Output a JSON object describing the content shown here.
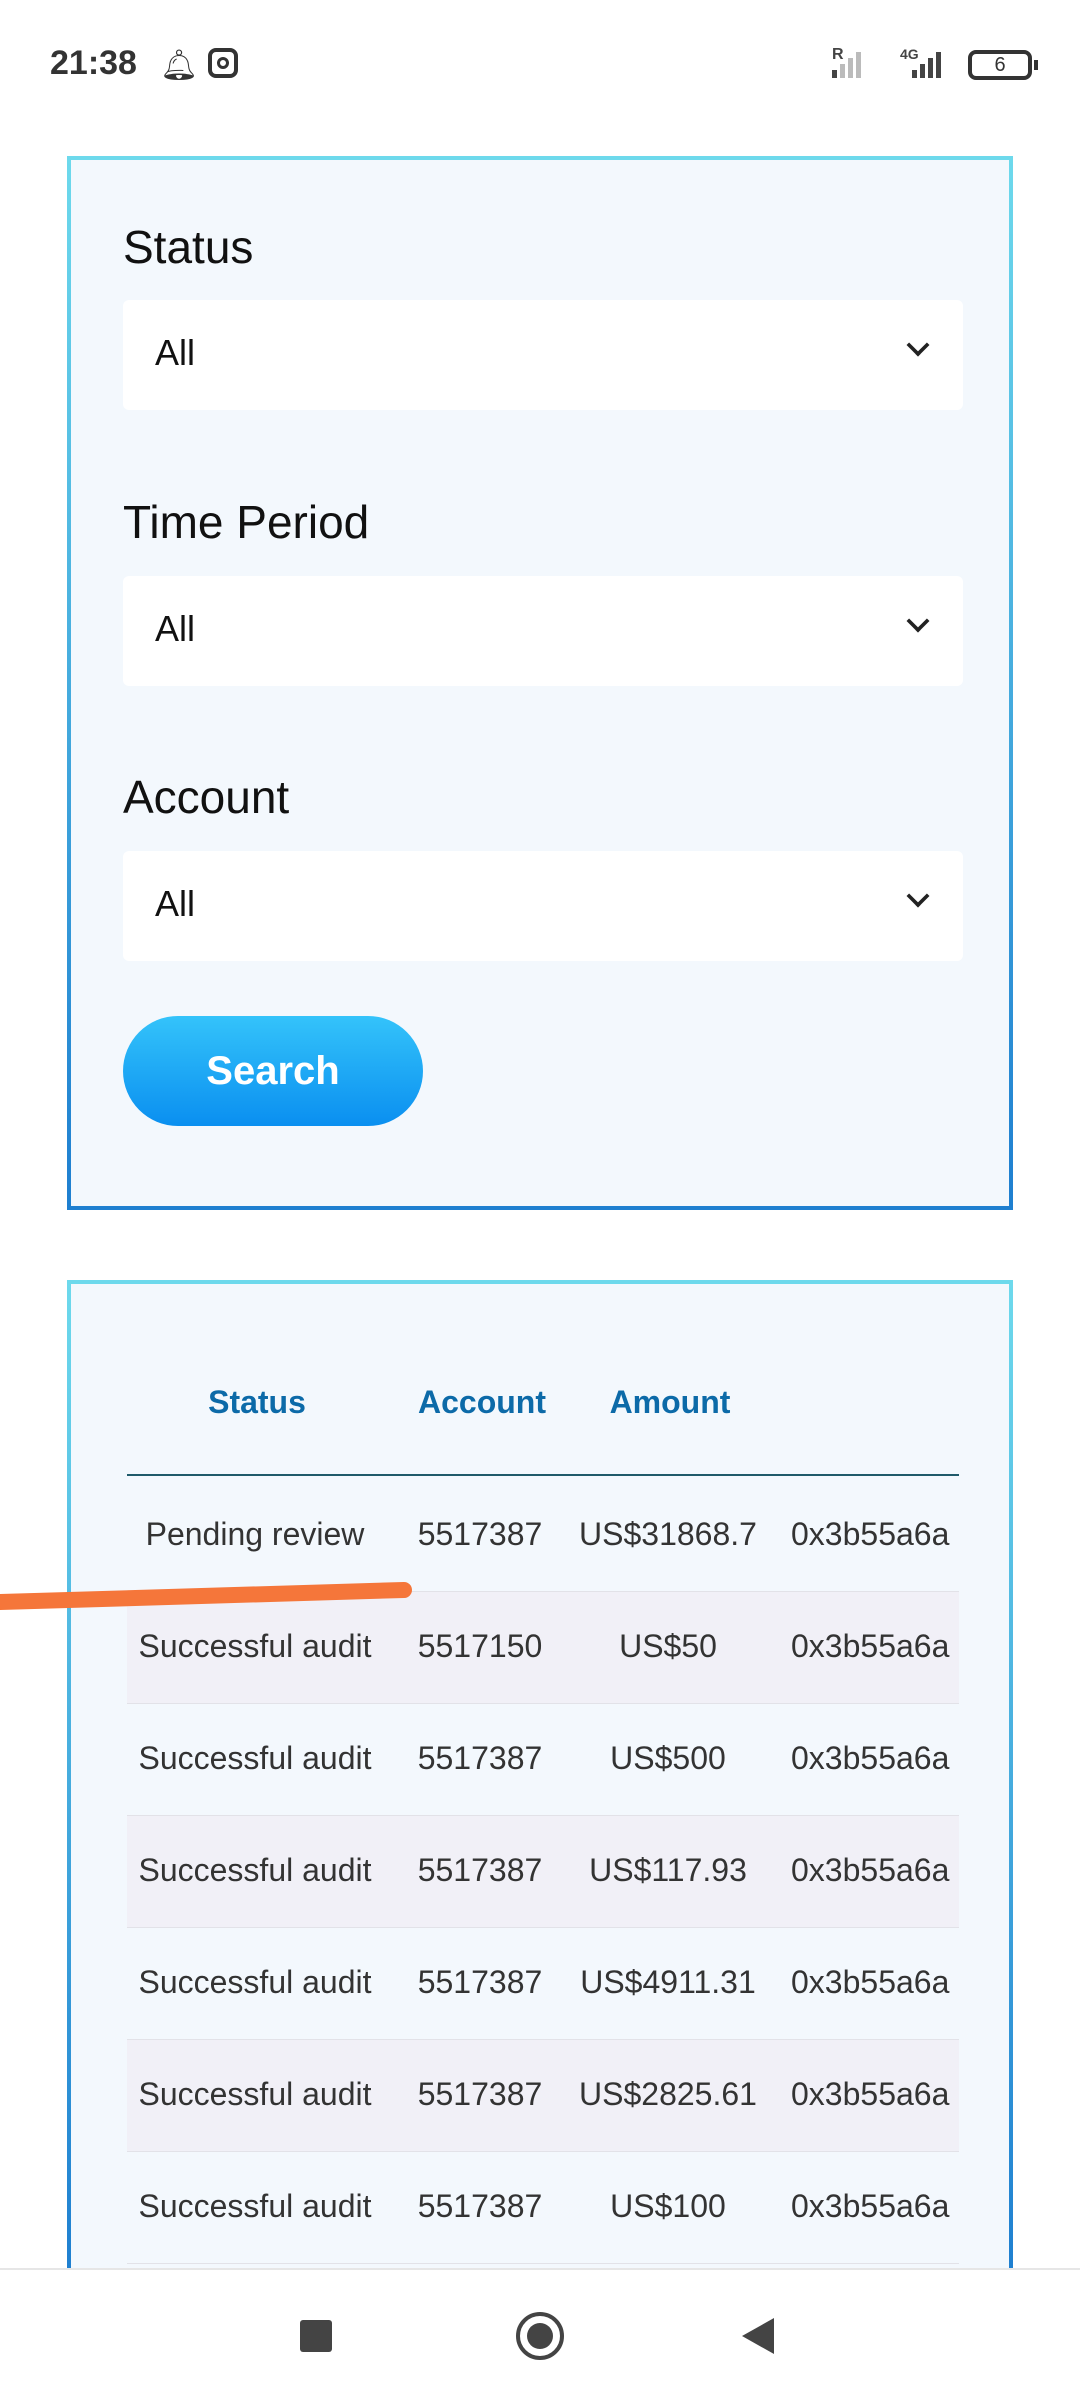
{
  "status_bar": {
    "time": "21:38",
    "signal1_label": "R",
    "signal2_label": "4G",
    "battery": "6"
  },
  "filters": {
    "status": {
      "label": "Status",
      "value": "All"
    },
    "time_period": {
      "label": "Time Period",
      "value": "All"
    },
    "account": {
      "label": "Account",
      "value": "All"
    },
    "search_label": "Search"
  },
  "table": {
    "headers": [
      "Status",
      "Account",
      "Amount"
    ],
    "rows": [
      [
        "Pending review",
        "5517387",
        "US$31868.7",
        "0x3b55a6a"
      ],
      [
        "Successful audit",
        "5517150",
        "US$50",
        "0x3b55a6a"
      ],
      [
        "Successful audit",
        "5517387",
        "US$500",
        "0x3b55a6a"
      ],
      [
        "Successful audit",
        "5517387",
        "US$117.93",
        "0x3b55a6a"
      ],
      [
        "Successful audit",
        "5517387",
        "US$4911.31",
        "0x3b55a6a"
      ],
      [
        "Successful audit",
        "5517387",
        "US$2825.61",
        "0x3b55a6a"
      ],
      [
        "Successful audit",
        "5517387",
        "US$100",
        "0x3b55a6a"
      ]
    ]
  },
  "colors": {
    "accent": "#0a8ff0",
    "header_text": "#0c6aa8",
    "annotation": "#f5763a"
  }
}
